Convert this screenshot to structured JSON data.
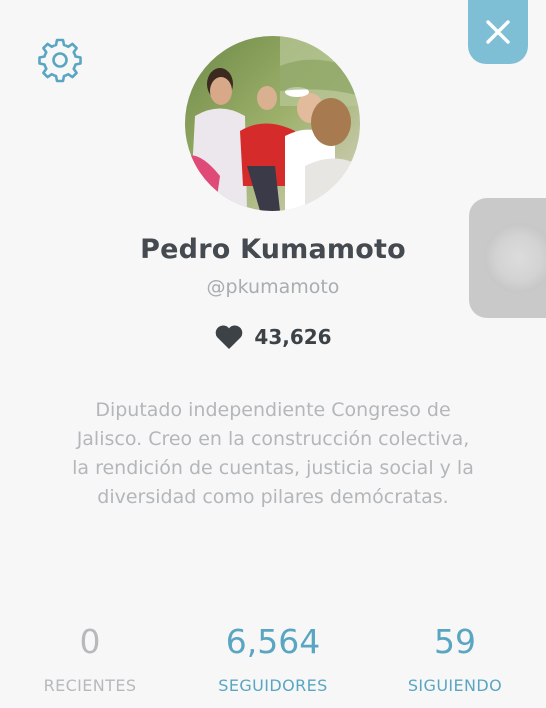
{
  "profile": {
    "name": "Pedro Kumamoto",
    "handle": "@pkumamoto",
    "likes": "43,626",
    "bio": "Diputado independiente Congreso de Jalisco. Creo en la construcción colectiva, la rendición de cuentas, justicia social y la diversidad como pilares demócratas."
  },
  "stats": [
    {
      "value": "0",
      "label": "RECIENTES"
    },
    {
      "value": "6,564",
      "label": "SEGUIDORES"
    },
    {
      "value": "59",
      "label": "SIGUIENDO"
    }
  ],
  "icons": {
    "settings": "gear-icon",
    "close": "close-icon",
    "likes": "heart-icon"
  },
  "colors": {
    "accent": "#5aa6c2",
    "close_bg": "#7fbfd6",
    "muted": "#b6babd",
    "name": "#444a4f"
  }
}
